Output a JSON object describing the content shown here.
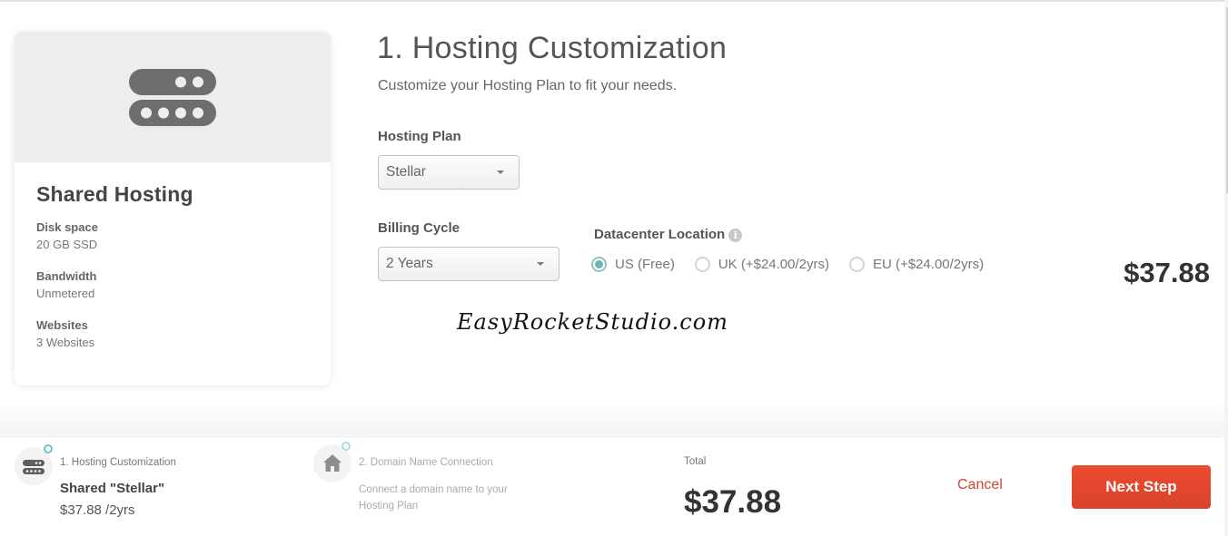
{
  "plan_card": {
    "title": "Shared Hosting",
    "icon": "server-icon",
    "specs": [
      {
        "label": "Disk space",
        "value": "20 GB SSD"
      },
      {
        "label": "Bandwidth",
        "value": "Unmetered"
      },
      {
        "label": "Websites",
        "value": "3 Websites"
      }
    ]
  },
  "main": {
    "title": "1. Hosting Customization",
    "subtitle": "Customize your Hosting Plan to fit your needs.",
    "hosting_plan": {
      "label": "Hosting Plan",
      "selected": "Stellar"
    },
    "billing_cycle": {
      "label": "Billing Cycle",
      "selected": "2 Years"
    },
    "datacenter": {
      "label": "Datacenter Location",
      "info_icon": "info-icon",
      "options": [
        {
          "label": "US (Free)",
          "checked": true
        },
        {
          "label": "UK (+$24.00/2yrs)",
          "checked": false
        },
        {
          "label": "EU (+$24.00/2yrs)",
          "checked": false
        }
      ]
    },
    "price": "$37.88",
    "watermark": "EasyRocketStudio.com"
  },
  "footer": {
    "steps": [
      {
        "label": "1. Hosting Customization",
        "name": "Shared \"Stellar\"",
        "price": "$37.88 /2yrs",
        "icon": "server-icon"
      },
      {
        "label": "2. Domain Name Connection",
        "description": "Connect a domain name to your Hosting Plan",
        "icon": "home-icon"
      }
    ],
    "total_label": "Total",
    "total_value": "$37.88",
    "cancel_label": "Cancel",
    "next_label": "Next Step"
  },
  "colors": {
    "accent": "#e44a2f",
    "radio_checked": "#6fb3b3",
    "step_ring": "#6cc4c8"
  }
}
